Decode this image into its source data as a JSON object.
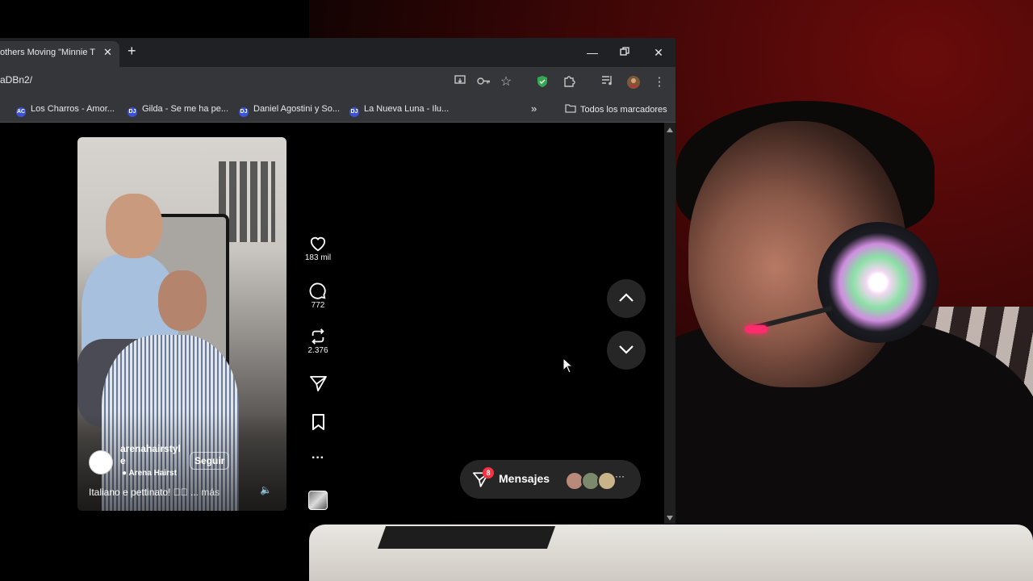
{
  "browser": {
    "tab_title": "others Moving \"Minnie T",
    "url_fragment": "aDBn2/",
    "bookmarks": [
      {
        "favicon": "AC",
        "label": "Los Charros - Amor..."
      },
      {
        "favicon": "DJ",
        "label": "Gilda - Se me ha pe..."
      },
      {
        "favicon": "DJ",
        "label": "Daniel Agostini y So..."
      },
      {
        "favicon": "DJ",
        "label": "La Nueva Luna - Ilu..."
      }
    ],
    "all_bookmarks": "Todos los marcadores"
  },
  "reel": {
    "username": "arenahairstyle",
    "follow_label": "Seguir",
    "location": "Arena Hairst",
    "caption": "Italiano e pettinato! ✂🏻 ...",
    "more": "más"
  },
  "actions": {
    "likes": "183 mil",
    "comments": "772",
    "reposts": "2.376"
  },
  "messages": {
    "label": "Mensajes",
    "badge": "8"
  },
  "colors": {
    "tab_bar": "#202124",
    "toolbar": "#35363a",
    "instagram_badge": "#ff3040",
    "shield_green": "#34a853"
  }
}
